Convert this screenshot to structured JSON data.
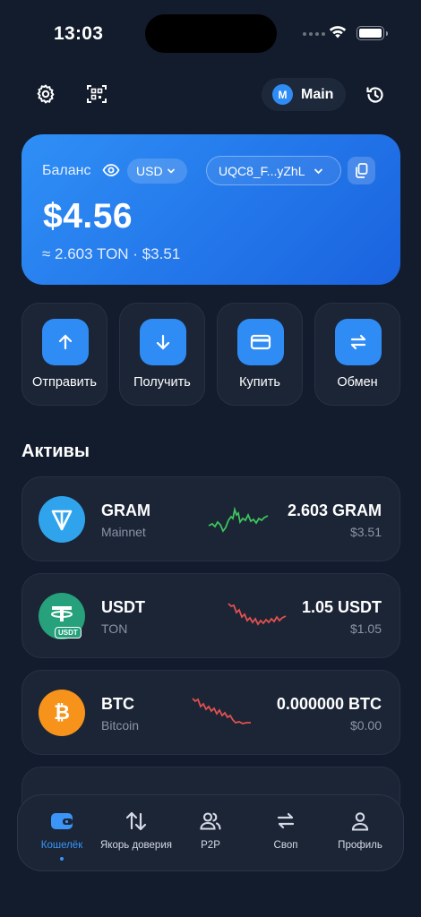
{
  "status": {
    "time": "13:03"
  },
  "header": {
    "wallet_badge": "M",
    "wallet_name": "Main"
  },
  "balance": {
    "label": "Баланс",
    "currency": "USD",
    "address": "UQC8_F...yZhL",
    "amount": "$4.56",
    "sub": "≈ 2.603 TON · $3.51"
  },
  "actions": [
    {
      "label": "Отправить",
      "icon": "arrow-up-icon"
    },
    {
      "label": "Получить",
      "icon": "arrow-down-icon"
    },
    {
      "label": "Купить",
      "icon": "card-icon"
    },
    {
      "label": "Обмен",
      "icon": "swap-icon"
    }
  ],
  "assets_title": "Активы",
  "assets": [
    {
      "symbol": "GRAM",
      "network": "Mainnet",
      "amount": "2.603 GRAM",
      "fiat": "$3.51",
      "trend_color": "#3ec45a",
      "logo_color": "#2fa4ec"
    },
    {
      "symbol": "USDT",
      "network": "TON",
      "amount": "1.05 USDT",
      "fiat": "$1.05",
      "trend_color": "#e2504f",
      "logo_color": "#26a17b",
      "logo_tag": "USDT"
    },
    {
      "symbol": "BTC",
      "network": "Bitcoin",
      "amount": "0.000000 BTC",
      "fiat": "$0.00",
      "trend_color": "#e2504f",
      "logo_color": "#f7931a",
      "logo_glyph": "₿"
    }
  ],
  "tabs": [
    {
      "label": "Кошелёк",
      "active": true
    },
    {
      "label": "Якорь доверия"
    },
    {
      "label": "P2P"
    },
    {
      "label": "Своп"
    },
    {
      "label": "Профиль"
    }
  ],
  "colors": {
    "accent": "#2f8cf5",
    "background": "#131c2c",
    "card": "#1b2536"
  }
}
